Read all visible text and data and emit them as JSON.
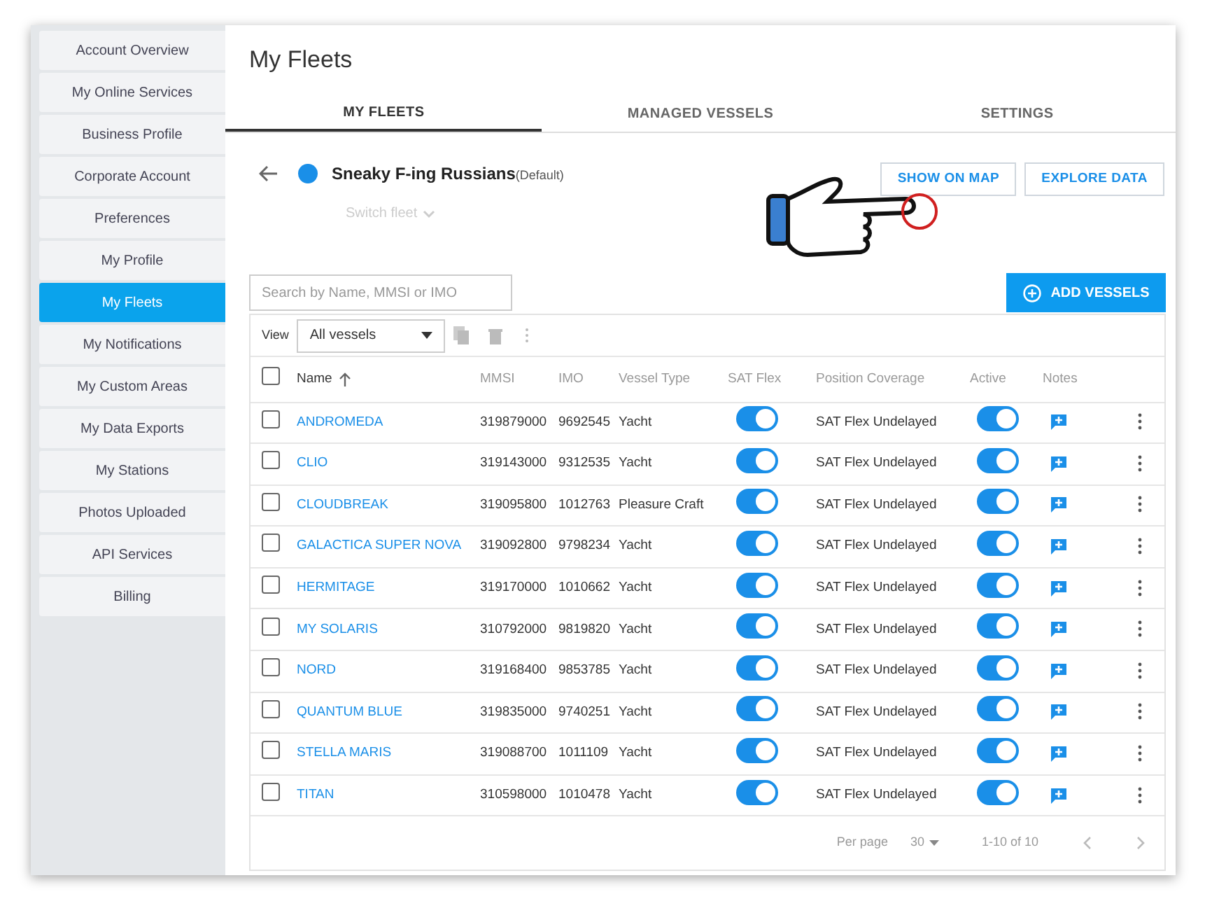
{
  "sidebar": {
    "items": [
      {
        "label": "Account Overview",
        "selected": false
      },
      {
        "label": "My Online Services",
        "selected": false
      },
      {
        "label": "Business Profile",
        "selected": false
      },
      {
        "label": "Corporate Account",
        "selected": false
      },
      {
        "label": "Preferences",
        "selected": false
      },
      {
        "label": "My Profile",
        "selected": false
      },
      {
        "label": "My Fleets",
        "selected": true
      },
      {
        "label": "My Notifications",
        "selected": false
      },
      {
        "label": "My Custom Areas",
        "selected": false
      },
      {
        "label": "My Data Exports",
        "selected": false
      },
      {
        "label": "My Stations",
        "selected": false
      },
      {
        "label": "Photos Uploaded",
        "selected": false
      },
      {
        "label": "API Services",
        "selected": false
      },
      {
        "label": "Billing",
        "selected": false
      }
    ]
  },
  "page_title": "My Fleets",
  "tabs": [
    {
      "label": "MY FLEETS",
      "selected": true
    },
    {
      "label": "MANAGED VESSELS",
      "selected": false
    },
    {
      "label": "SETTINGS",
      "selected": false
    }
  ],
  "fleet": {
    "name": "Sneaky F-ing Russians",
    "note": "(Default)",
    "color": "#1a8fe8",
    "switch_label": "Switch fleet"
  },
  "actions": [
    "SHOW ON MAP",
    "EXPLORE DATA"
  ],
  "search": {
    "placeholder": "Search by Name, MMSI or IMO"
  },
  "add_button": "ADD VESSELS",
  "view": {
    "label": "View",
    "value": "All vessels"
  },
  "table": {
    "select_all_checked": false,
    "columns": [
      "Name",
      "MMSI",
      "IMO",
      "Vessel Type",
      "SAT Flex",
      "Position Coverage",
      "Active",
      "Notes"
    ],
    "rows": [
      {
        "name": "ANDROMEDA",
        "mmsi": "319879000",
        "imo": "9692545",
        "type": "Yacht",
        "sat_flex": true,
        "coverage": "SAT Flex Undelayed",
        "active": true,
        "checked": false
      },
      {
        "name": "CLIO",
        "mmsi": "319143000",
        "imo": "9312535",
        "type": "Yacht",
        "sat_flex": true,
        "coverage": "SAT Flex Undelayed",
        "active": true,
        "checked": false
      },
      {
        "name": "CLOUDBREAK",
        "mmsi": "319095800",
        "imo": "1012763",
        "type": "Pleasure Craft",
        "sat_flex": true,
        "coverage": "SAT Flex Undelayed",
        "active": true,
        "checked": false
      },
      {
        "name": "GALACTICA SUPER NOVA",
        "mmsi": "319092800",
        "imo": "9798234",
        "type": "Yacht",
        "sat_flex": true,
        "coverage": "SAT Flex Undelayed",
        "active": true,
        "checked": false
      },
      {
        "name": "HERMITAGE",
        "mmsi": "319170000",
        "imo": "1010662",
        "type": "Yacht",
        "sat_flex": true,
        "coverage": "SAT Flex Undelayed",
        "active": true,
        "checked": false
      },
      {
        "name": "MY SOLARIS",
        "mmsi": "310792000",
        "imo": "9819820",
        "type": "Yacht",
        "sat_flex": true,
        "coverage": "SAT Flex Undelayed",
        "active": true,
        "checked": false
      },
      {
        "name": "NORD",
        "mmsi": "319168400",
        "imo": "9853785",
        "type": "Yacht",
        "sat_flex": true,
        "coverage": "SAT Flex Undelayed",
        "active": true,
        "checked": false
      },
      {
        "name": "QUANTUM BLUE",
        "mmsi": "319835000",
        "imo": "9740251",
        "type": "Yacht",
        "sat_flex": true,
        "coverage": "SAT Flex Undelayed",
        "active": true,
        "checked": false
      },
      {
        "name": "STELLA MARIS",
        "mmsi": "319088700",
        "imo": "1011109",
        "type": "Yacht",
        "sat_flex": true,
        "coverage": "SAT Flex Undelayed",
        "active": true,
        "checked": false
      },
      {
        "name": "TITAN",
        "mmsi": "310598000",
        "imo": "1010478",
        "type": "Yacht",
        "sat_flex": true,
        "coverage": "SAT Flex Undelayed",
        "active": true,
        "checked": false
      }
    ]
  },
  "pagination": {
    "per_page_label": "Per page",
    "per_page": "30",
    "range": "1-10 of 10"
  }
}
